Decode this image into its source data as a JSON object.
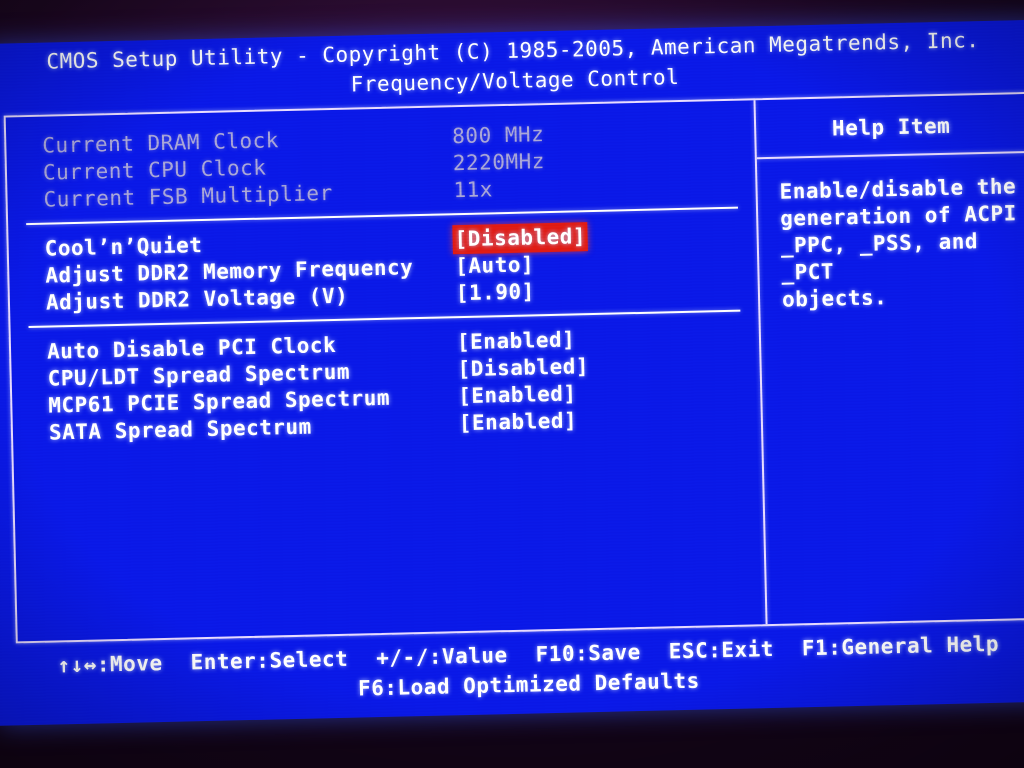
{
  "header": {
    "title": "CMOS Setup Utility - Copyright (C) 1985-2005, American Megatrends, Inc.",
    "subtitle": "Frequency/Voltage Control"
  },
  "colors": {
    "screen_background": "#0a19e8",
    "text_primary": "#ffffff",
    "text_disabled": "#a9a6d8",
    "selection_background": "#e01b14",
    "border": "#e8dcff"
  },
  "settings": {
    "groups": [
      {
        "rows": [
          {
            "label": "Current DRAM Clock",
            "value": "800 MHz",
            "state": "readonly",
            "selected": false
          },
          {
            "label": "Current CPU Clock",
            "value": "2220MHz",
            "state": "readonly",
            "selected": false
          },
          {
            "label": "Current FSB Multiplier",
            "value": "11x",
            "state": "readonly",
            "selected": false
          }
        ]
      },
      {
        "rows": [
          {
            "label": "Cool’n’Quiet",
            "value": "[Disabled]",
            "state": "editable",
            "selected": true
          },
          {
            "label": "Adjust DDR2 Memory Frequency",
            "value": "[Auto]",
            "state": "editable",
            "selected": false
          },
          {
            "label": "Adjust DDR2 Voltage (V)",
            "value": "[1.90]",
            "state": "editable",
            "selected": false
          }
        ]
      },
      {
        "rows": [
          {
            "label": "Auto Disable PCI Clock",
            "value": "[Enabled]",
            "state": "editable",
            "selected": false
          },
          {
            "label": "CPU/LDT Spread Spectrum",
            "value": "[Disabled]",
            "state": "editable",
            "selected": false
          },
          {
            "label": "MCP61 PCIE Spread Spectrum",
            "value": "[Enabled]",
            "state": "editable",
            "selected": false
          },
          {
            "label": "SATA Spread Spectrum",
            "value": "[Enabled]",
            "state": "editable",
            "selected": false
          }
        ]
      }
    ]
  },
  "help": {
    "title": "Help Item",
    "body": "Enable/disable the\ngeneration of ACPI\n_PPC, _PSS, and _PCT\nobjects."
  },
  "footer": {
    "line1": [
      "↑↓↔:Move",
      "Enter:Select",
      "+/-/:Value",
      "F10:Save",
      "ESC:Exit",
      "F1:General Help"
    ],
    "line2": [
      "F6:Load Optimized Defaults"
    ]
  }
}
